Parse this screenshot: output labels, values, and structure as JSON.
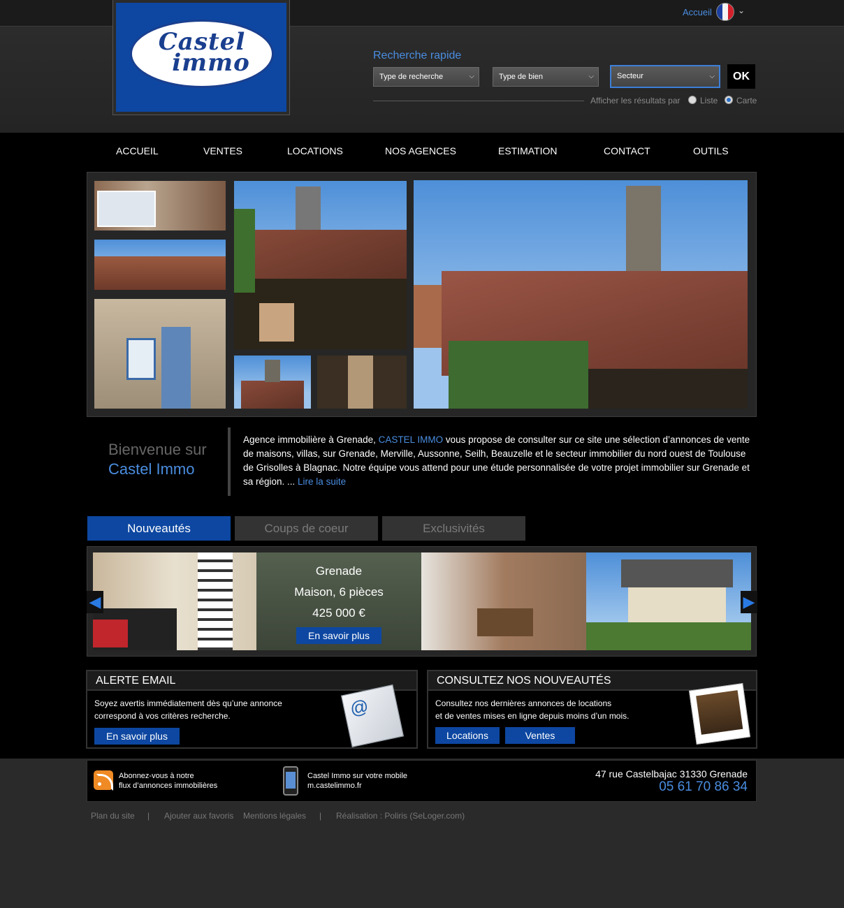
{
  "header": {
    "logo_line1": "Castel",
    "logo_line2": "immo",
    "accueil_link": "Accueil",
    "language_icon": "france-flag-icon",
    "search": {
      "title": "Recherche rapide",
      "type_recherche": "Type de recherche",
      "type_bien": "Type de bien",
      "secteur": "Secteur",
      "ok_label": "OK",
      "display_label": "Afficher les résultats par",
      "option_list": "Liste",
      "option_map": "Carte",
      "selected_option": "Carte"
    }
  },
  "nav": {
    "items": [
      "ACCUEIL",
      "VENTES",
      "LOCATIONS",
      "NOS AGENCES",
      "ESTIMATION",
      "CONTACT",
      "OUTILS"
    ]
  },
  "welcome": {
    "line1": "Bienvenue sur",
    "line2": "Castel Immo",
    "text_before": "Agence immobilière à Grenade, ",
    "text_brand": "CASTEL IMMO",
    "text_after": " vous propose de consulter sur ce site une sélection d’annonces de vente de maisons, villas, sur Grenade, Merville, Aussonne, Seilh, Beauzelle et le secteur immobilier du nord ouest de Toulouse de Grisolles à Blagnac. Notre équipe vous attend pour une étude personnalisée de votre projet immobilier sur Grenade et sa région. ... ",
    "read_more": "Lire la suite"
  },
  "tabs": {
    "items": [
      "Nouveautés",
      "Coups de coeur",
      "Exclusivités"
    ],
    "active": "Nouveautés"
  },
  "featured": {
    "city": "Grenade",
    "type": "Maison, 6 pièces",
    "price": "425 000 €",
    "button": "En savoir plus"
  },
  "alert_box": {
    "title": "ALERTE EMAIL",
    "text_line1": "Soyez avertis immédiatement dès qu’une annonce",
    "text_line2": "correspond à vos critères recherche.",
    "button": "En savoir plus",
    "icon": "email-envelope-icon"
  },
  "news_box": {
    "title": "CONSULTEZ NOS NOUVEAUTÉS",
    "text_line1": "Consultez nos dernières annonces de locations",
    "text_line2": "et de ventes mises en ligne depuis moins d’un mois.",
    "button_locations": "Locations",
    "button_ventes": "Ventes",
    "icon": "photo-stack-icon"
  },
  "footer": {
    "rss_line1": "Abonnez-vous à notre",
    "rss_line2": "flux d’annonces immobilières",
    "mobile_line1": "Castel Immo sur votre mobile",
    "mobile_line2": "m.castelimmo.fr",
    "address": "47 rue Castelbajac 31330 Grenade",
    "phone": "05 61 70 86 34",
    "links": [
      "Plan du site",
      "|",
      "Ajouter aux favoris",
      "Mentions légales",
      "|",
      "Réalisation : Poliris (SeLoger.com)"
    ]
  },
  "colors": {
    "accent_blue": "#0d47a1",
    "link_blue": "#4a8de0",
    "background": "#2a2a2a"
  }
}
